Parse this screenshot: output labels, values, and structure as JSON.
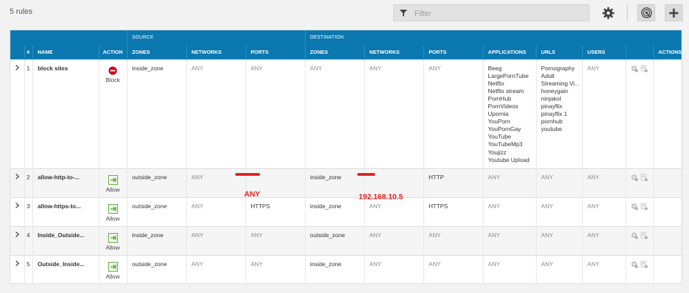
{
  "toolbar": {
    "rules_count": "5 rules",
    "filter_placeholder": "Filter",
    "icons": [
      "filter-icon",
      "gear-icon",
      "deploy-icon",
      "plus-icon"
    ]
  },
  "table": {
    "group_headers": {
      "source": "SOURCE",
      "destination": "DESTINATION"
    },
    "columns": {
      "num": "#",
      "name": "NAME",
      "action": "ACTION",
      "src_zones": "ZONES",
      "src_networks": "NETWORKS",
      "src_ports": "PORTS",
      "dst_zones": "ZONES",
      "dst_networks": "NETWORKS",
      "dst_ports": "PORTS",
      "applications": "APPLICATIONS",
      "urls": "URLS",
      "users": "USERS",
      "actions": "ACTIONS"
    },
    "rows": [
      {
        "num": "1",
        "name": "block sites",
        "action": "Block",
        "src_zones": "inside_zone",
        "src_networks": "ANY",
        "src_ports": "ANY",
        "dst_zones": "ANY",
        "dst_networks": "ANY",
        "dst_ports": "ANY",
        "applications": [
          "Beeg",
          "LargePornTube",
          "Netflix",
          "Netflix stream",
          "PornHub",
          "PornVideos",
          "Upornia",
          "YouPorn",
          "YouPornGay",
          "YouTube",
          "YouTubeMp3",
          "Youjizz",
          "Youtube Upload"
        ],
        "urls": [
          "Pornography",
          "Adult",
          "Streaming Vi...",
          "honeygain",
          "ninjakol",
          "pinayflix",
          "pinayflix 1",
          "pornhub",
          "youtube"
        ],
        "users": "ANY"
      },
      {
        "num": "2",
        "name": "allow-http-to-...",
        "action": "Allow",
        "src_zones": "outside_zone",
        "src_networks": "ANY",
        "src_ports": "",
        "dst_zones": "inside_zone",
        "dst_networks": "",
        "dst_ports": "HTTP",
        "applications": [
          "ANY"
        ],
        "urls": [
          "ANY"
        ],
        "users": "ANY"
      },
      {
        "num": "3",
        "name": "allow-https-to...",
        "action": "Allow",
        "src_zones": "outside_zone",
        "src_networks": "ANY",
        "src_ports": "HTTPS",
        "dst_zones": "inside_zone",
        "dst_networks": "ANY",
        "dst_ports": "HTTPS",
        "applications": [
          "ANY"
        ],
        "urls": [
          "ANY"
        ],
        "users": "ANY"
      },
      {
        "num": "4",
        "name": "Inside_Outside...",
        "action": "Allow",
        "src_zones": "inside_zone",
        "src_networks": "ANY",
        "src_ports": "ANY",
        "dst_zones": "outside_zone",
        "dst_networks": "ANY",
        "dst_ports": "ANY",
        "applications": [
          "ANY"
        ],
        "urls": [
          "ANY"
        ],
        "users": "ANY"
      },
      {
        "num": "5",
        "name": "Outside_Inside...",
        "action": "Allow",
        "src_zones": "outside_zone",
        "src_networks": "ANY",
        "src_ports": "ANY",
        "dst_zones": "inside_zone",
        "dst_networks": "ANY",
        "dst_ports": "ANY",
        "applications": [
          "ANY"
        ],
        "urls": [
          "ANY"
        ],
        "users": "ANY"
      }
    ]
  },
  "annotations": {
    "src_port_note": "ANY",
    "dst_network_note": "192.168.10.5",
    "color": "#e02323"
  },
  "colors": {
    "header_bg": "#0b78b0",
    "block_red": "#d0021b",
    "allow_green": "#5cb032"
  }
}
